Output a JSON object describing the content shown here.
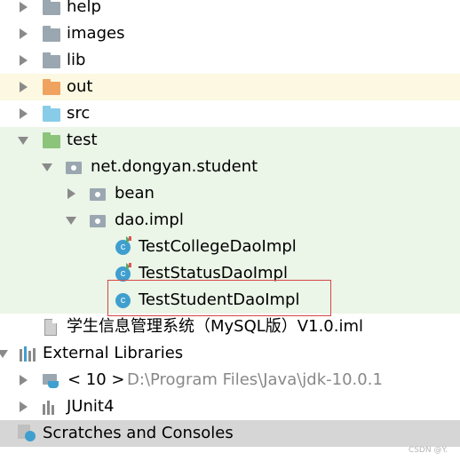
{
  "tree": {
    "help": "help",
    "images": "images",
    "lib": "lib",
    "out": "out",
    "src": "src",
    "test": "test",
    "package_student": "net.dongyan.student",
    "package_bean": "bean",
    "package_dao_impl": "dao.impl",
    "class_college": "TestCollegeDaoImpl",
    "class_status": "TestStatusDaoImpl",
    "class_student": "TestStudentDaoImpl",
    "iml_file": "学生信息管理系统（MySQL版）V1.0.iml",
    "external_libraries": "External Libraries",
    "sdk_name": "< 10 >",
    "sdk_path": "D:\\Program Files\\Java\\jdk-10.0.1",
    "junit": "JUnit4",
    "scratches": "Scratches and Consoles"
  },
  "icons": {
    "class_letter": "c"
  },
  "colors": {
    "folder": "#9aa7b0",
    "out_folder": "#f0a35e",
    "src_folder": "#88cce8",
    "test_folder": "#8bc47a",
    "class_icon": "#3f9fcf",
    "highlight_border": "#d64545",
    "selection": "#d6d6d6"
  },
  "watermark": "CSDN @Y."
}
